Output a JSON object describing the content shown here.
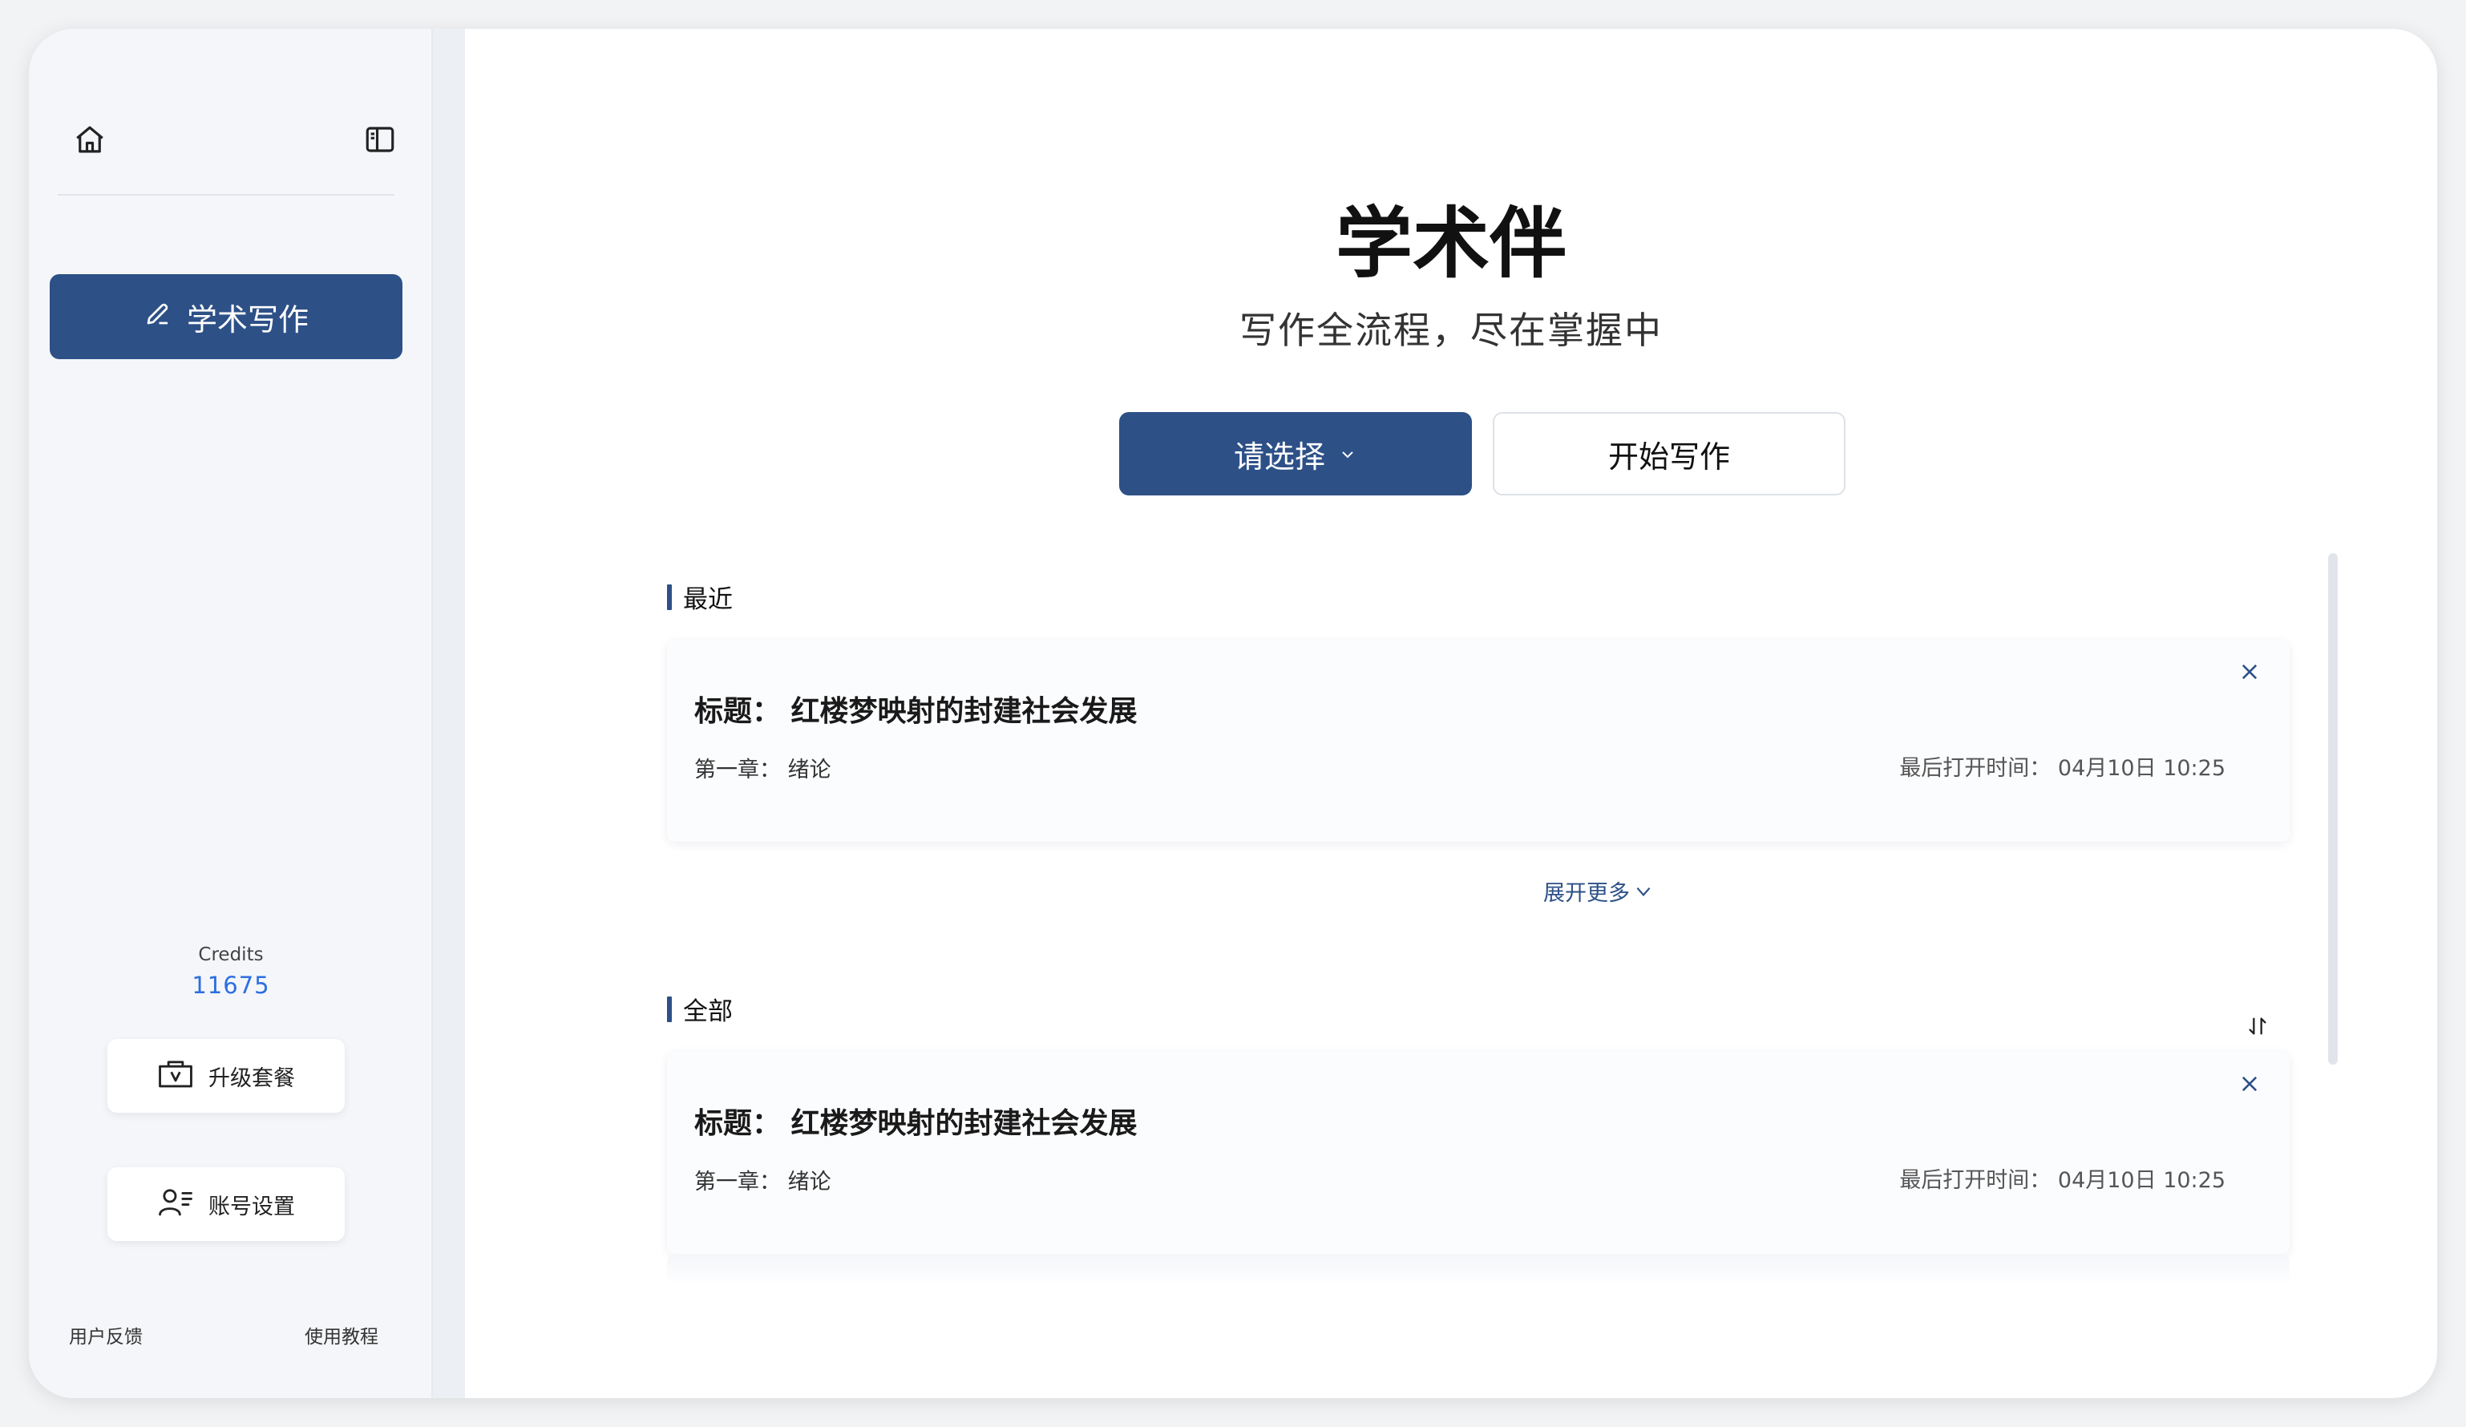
{
  "sidebar": {
    "nav": [
      {
        "label": "学术写作",
        "icon": "pencil-icon"
      }
    ],
    "credits": {
      "label": "Credits",
      "value": "11675"
    },
    "upgrade_label": "升级套餐",
    "account_label": "账号设置",
    "feedback_label": "用户反馈",
    "tutorial_label": "使用教程"
  },
  "main": {
    "title": "学术伴",
    "subtitle": "写作全流程，尽在掌握中",
    "select_label": "请选择",
    "start_label": "开始写作",
    "recent": {
      "label": "最近",
      "items": [
        {
          "title": "标题：  红楼梦映射的封建社会发展",
          "chapter": "第一章：  绪论",
          "time": "最后打开时间：  04月10日 10:25"
        }
      ],
      "expand_label": "展开更多"
    },
    "all": {
      "label": "全部",
      "items": [
        {
          "title": "标题：  红楼梦映射的封建社会发展",
          "chapter": "第一章：  绪论",
          "time": "最后打开时间：  04月10日 10:25"
        }
      ]
    }
  },
  "colors": {
    "accent": "#2d5087",
    "credits_value": "#2d6ee0"
  }
}
